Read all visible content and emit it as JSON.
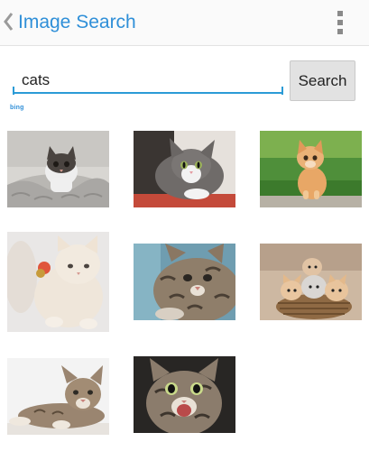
{
  "action_bar": {
    "title": "Image Search",
    "back_icon": "chevron-left-icon",
    "overflow_icon": "overflow-menu-icon"
  },
  "search": {
    "query": "cats",
    "button_label": "Search"
  },
  "provider": {
    "logo_text": "bing"
  },
  "results": [
    {
      "subject": "kitten-in-knit-blanket"
    },
    {
      "subject": "grey-white-kitten"
    },
    {
      "subject": "ginger-kitten-on-grass"
    },
    {
      "subject": "fluffy-cream-kitten"
    },
    {
      "subject": "tabby-kitten-closeup"
    },
    {
      "subject": "kittens-in-basket"
    },
    {
      "subject": "tabby-cat-lying"
    },
    {
      "subject": "excited-tabby-kitten"
    }
  ],
  "colors": {
    "accent": "#2f8fd8",
    "input_underline": "#2b9bd6",
    "button_bg": "#e2e2e2"
  }
}
